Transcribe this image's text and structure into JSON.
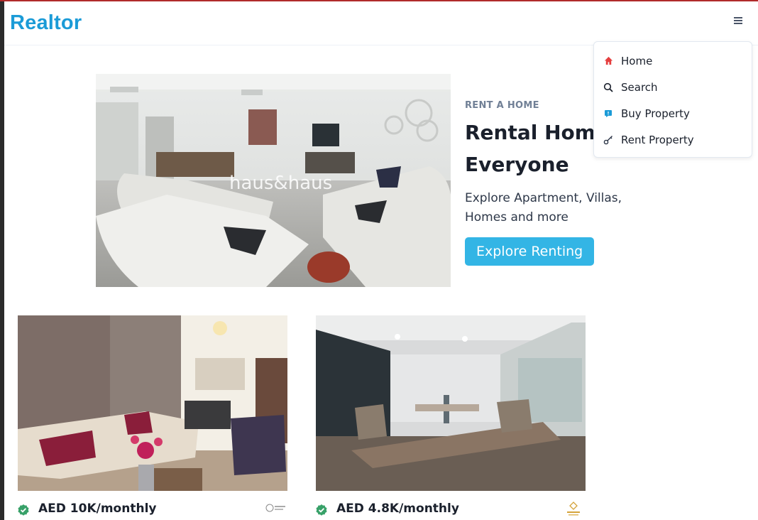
{
  "brand": {
    "name": "Realtor",
    "color": "#1b9bd7"
  },
  "nav": {
    "menu_icon": "hamburger-icon",
    "items": [
      {
        "label": "Home",
        "icon": "home-icon"
      },
      {
        "label": "Search",
        "icon": "search-icon"
      },
      {
        "label": "Buy Property",
        "icon": "tag-icon"
      },
      {
        "label": "Rent Property",
        "icon": "key-icon"
      }
    ]
  },
  "hero": {
    "eyebrow": "RENT A HOME",
    "title": "Rental Homes for Everyone",
    "description": "Explore Apartment, Villas, Homes and more",
    "button": "Explore Renting",
    "watermark": "haus&haus"
  },
  "listings": [
    {
      "price": "AED 10K/monthly",
      "verified": true,
      "agency_logo": "agency-logo"
    },
    {
      "price": "AED 4.8K/monthly",
      "verified": true,
      "agency_logo": "agency-logo"
    }
  ],
  "colors": {
    "accent": "#33b5e5",
    "verified": "#38a169"
  }
}
